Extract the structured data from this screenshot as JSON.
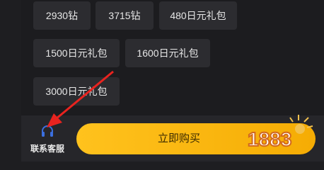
{
  "packages": [
    {
      "label": "2930钻"
    },
    {
      "label": "3715钻"
    },
    {
      "label": "480日元礼包"
    },
    {
      "label": "1500日元礼包"
    },
    {
      "label": "1600日元礼包"
    },
    {
      "label": "3000日元礼包"
    }
  ],
  "footer": {
    "support_label": "联系客服",
    "buy_label": "立即购买"
  },
  "icons": {
    "support": "headset-icon",
    "annotation": "red-arrow-icon",
    "watermark": "1883-logo"
  },
  "colors": {
    "background": "#1e1e21",
    "chip": "#2c2c30",
    "buy_button": "#ffc21d",
    "support_icon": "#3b6fe0",
    "annotation_arrow": "#e8231f"
  },
  "watermark_text": "1883"
}
